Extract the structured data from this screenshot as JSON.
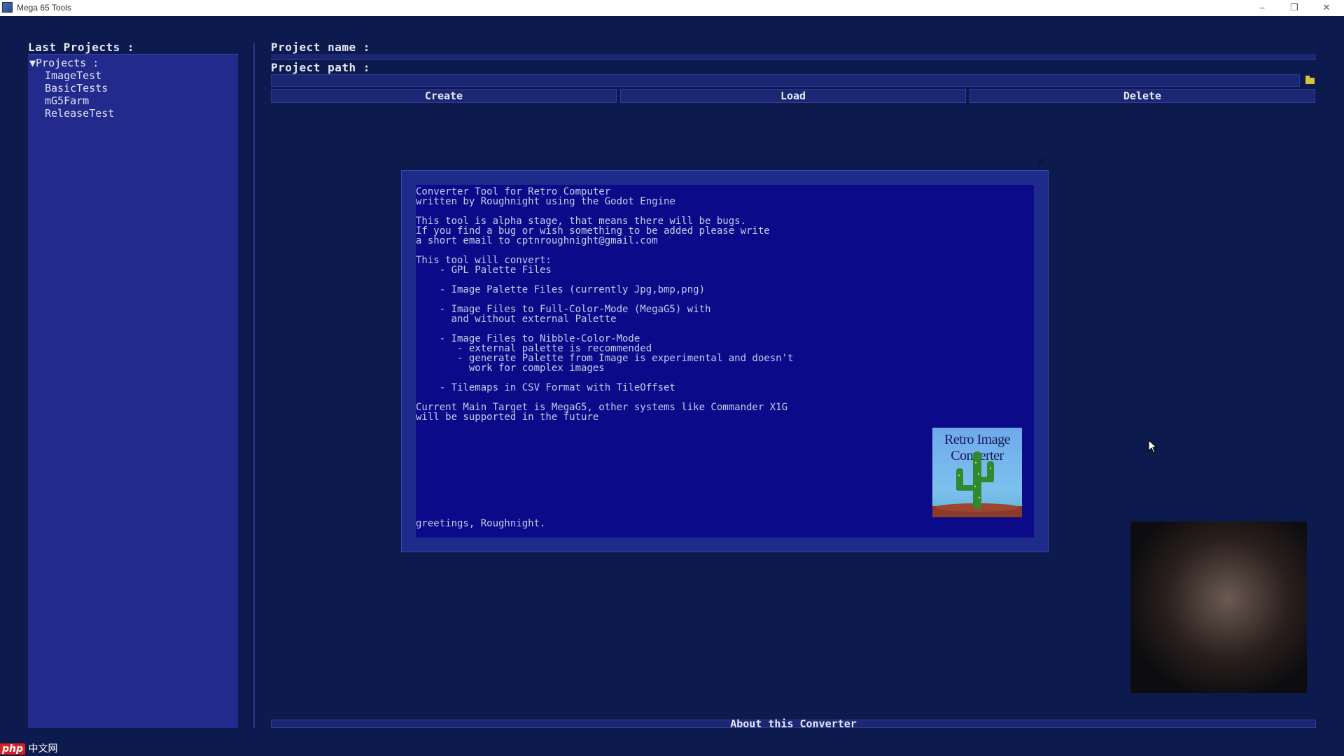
{
  "window": {
    "title": "Mega 65 Tools",
    "minimize": "–",
    "restore": "❐",
    "close": "✕"
  },
  "sidebar": {
    "title": "Last Projects :",
    "root": "▼Projects :",
    "items": [
      "ImageTest",
      "BasicTests",
      "mG5Farm",
      "ReleaseTest"
    ]
  },
  "form": {
    "name_label": "Project name :",
    "path_label": "Project path :",
    "name_value": "",
    "path_value": ""
  },
  "actions": {
    "create": "Create",
    "load": "Load",
    "delete": "Delete"
  },
  "dialog": {
    "close": "✕",
    "body": "Converter Tool for Retro Computer\nwritten by Roughnight using the Godot Engine\n\nThis tool is alpha stage, that means there will be bugs.\nIf you find a bug or wish something to be added please write\na short email to cptnroughnight@gmail.com\n\nThis tool will convert:\n    - GPL Palette Files\n\n    - Image Palette Files (currently Jpg,bmp,png)\n\n    - Image Files to Full-Color-Mode (MegaG5) with\n      and without external Palette\n\n    - Image Files to Nibble-Color-Mode\n       - external palette is recommended\n       - generate Palette from Image is experimental and doesn't\n         work for complex images\n\n    - Tilemaps in CSV Format with TileOffset\n\nCurrent Main Target is MegaG5, other systems like Commander X1G\nwill be supported in the future",
    "greeting": "greetings, Roughnight.",
    "logo_text": "Retro Image Converter"
  },
  "footer": {
    "about": "About this Converter"
  },
  "watermark": {
    "badge": "php",
    "text": "中文网"
  },
  "colors": {
    "background": "#0c1a4e",
    "panel": "#222b8c",
    "dialog_inner": "#0b0b8a"
  }
}
